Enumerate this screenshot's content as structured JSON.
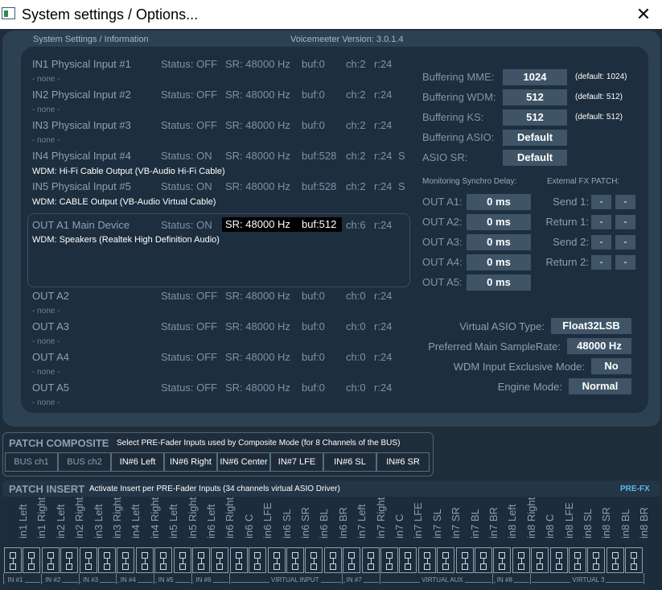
{
  "window": {
    "title": "System settings / Options...",
    "close_glyph": "✕"
  },
  "header": {
    "section": "System Settings / Information",
    "version": "Voicemeeter Version: 3.0.1.4"
  },
  "devices": [
    {
      "name": "IN1 Physical Input #1",
      "status": "Status: OFF",
      "sr": "SR: 48000 Hz",
      "buf": "buf:0",
      "ch": "ch:2",
      "r": "r:24",
      "s": "",
      "sub": "- none -"
    },
    {
      "name": "IN2 Physical Input #2",
      "status": "Status: OFF",
      "sr": "SR: 48000 Hz",
      "buf": "buf:0",
      "ch": "ch:2",
      "r": "r:24",
      "s": "",
      "sub": "- none -"
    },
    {
      "name": "IN3 Physical Input #3",
      "status": "Status: OFF",
      "sr": "SR: 48000 Hz",
      "buf": "buf:0",
      "ch": "ch:2",
      "r": "r:24",
      "s": "",
      "sub": "- none -"
    },
    {
      "name": "IN4 Physical Input #4",
      "status": "Status: ON",
      "sr": "SR: 48000 Hz",
      "buf": "buf:528",
      "ch": "ch:2",
      "r": "r:24",
      "s": "S",
      "sub": "WDM: Hi-Fi Cable Output (VB-Audio Hi-Fi Cable)"
    },
    {
      "name": "IN5 Physical Input #5",
      "status": "Status: ON",
      "sr": "SR: 48000 Hz",
      "buf": "buf:528",
      "ch": "ch:2",
      "r": "r:24",
      "s": "S",
      "sub": "WDM: CABLE Output (VB-Audio Virtual Cable)"
    }
  ],
  "out_a1": {
    "name": "OUT A1 Main Device",
    "status": "Status: ON",
    "sr": "SR: 48000 Hz",
    "buf": "buf:512",
    "ch": "ch:6",
    "r": "r:24",
    "sub": "WDM: Speakers (Realtek High Definition Audio)"
  },
  "outs": [
    {
      "name": "OUT A2",
      "status": "Status: OFF",
      "sr": "SR: 48000 Hz",
      "buf": "buf:0",
      "ch": "ch:0",
      "r": "r:24",
      "sub": "- none -"
    },
    {
      "name": "OUT A3",
      "status": "Status: OFF",
      "sr": "SR: 48000 Hz",
      "buf": "buf:0",
      "ch": "ch:0",
      "r": "r:24",
      "sub": "- none -"
    },
    {
      "name": "OUT A4",
      "status": "Status: OFF",
      "sr": "SR: 48000 Hz",
      "buf": "buf:0",
      "ch": "ch:0",
      "r": "r:24",
      "sub": "- none -"
    },
    {
      "name": "OUT A5",
      "status": "Status: OFF",
      "sr": "SR: 48000 Hz",
      "buf": "buf:0",
      "ch": "ch:0",
      "r": "r:24",
      "sub": "- none -"
    }
  ],
  "buffering": [
    {
      "label": "Buffering MME:",
      "value": "1024",
      "note": "(default: 1024)"
    },
    {
      "label": "Buffering WDM:",
      "value": "512",
      "note": "(default: 512)"
    },
    {
      "label": "Buffering KS:",
      "value": "512",
      "note": "(default: 512)"
    },
    {
      "label": "Buffering ASIO:",
      "value": "Default",
      "note": ""
    },
    {
      "label": "ASIO SR:",
      "value": "Default",
      "note": ""
    }
  ],
  "monitoring": {
    "title": "Monitoring Synchro Delay:",
    "rows": [
      {
        "label": "OUT A1:",
        "value": "0 ms"
      },
      {
        "label": "OUT A2:",
        "value": "0 ms"
      },
      {
        "label": "OUT A3:",
        "value": "0 ms"
      },
      {
        "label": "OUT A4:",
        "value": "0 ms"
      },
      {
        "label": "OUT A5:",
        "value": "0 ms"
      }
    ]
  },
  "fx_patch": {
    "title": "External FX PATCH:",
    "rows": [
      {
        "label": "Send 1:",
        "a": "-",
        "b": "-"
      },
      {
        "label": "Return 1:",
        "a": "-",
        "b": "-"
      },
      {
        "label": "Send 2:",
        "a": "-",
        "b": "-"
      },
      {
        "label": "Return 2:",
        "a": "-",
        "b": "-"
      }
    ]
  },
  "engine": [
    {
      "label": "Virtual ASIO Type:",
      "value": "Float32LSB"
    },
    {
      "label": "Preferred Main SampleRate:",
      "value": "48000 Hz"
    },
    {
      "label": "WDM Input Exclusive Mode:",
      "value": "No"
    },
    {
      "label": "Engine Mode:",
      "value": "Normal"
    }
  ],
  "patch_composite": {
    "title": "PATCH COMPOSITE",
    "desc": "Select PRE-Fader Inputs used by Composite Mode (for 8 Channels of the BUS)",
    "buttons": [
      "BUS ch1",
      "BUS ch2",
      "IN#6 Left",
      "IN#6 Right",
      "IN#6 Center",
      "IN#7 LFE",
      "IN#6 SL",
      "IN#6 SR"
    ]
  },
  "patch_insert": {
    "title": "PATCH INSERT",
    "desc": "Activate Insert per PRE-Fader Inputs (34 channels virtual ASIO Driver)",
    "prefx": "PRE-FX",
    "channels": [
      "in1 Left",
      "in1 Right",
      "in2 Left",
      "in2 Right",
      "in3 Left",
      "in3 Right",
      "in4 Left",
      "in4 Right",
      "in5 Left",
      "in5 Right",
      "in6 Left",
      "in6 Right",
      "in6 C",
      "in6 LFE",
      "in6 SL",
      "in6 SR",
      "in6 BL",
      "in6 BR",
      "in7 Left",
      "in7 Right",
      "in7 C",
      "in7 LFE",
      "in7 SL",
      "in7 SR",
      "in7 BL",
      "in7 BR",
      "in8 Left",
      "in8 Right",
      "in8 C",
      "in8 LFE",
      "in8 SL",
      "in8 SR",
      "in8 BL",
      "in8 BR"
    ],
    "groups": [
      "IN #1",
      "IN #2",
      "IN #3",
      "IN #4",
      "IN #5",
      "IN #6",
      "VIRTUAL INPUT",
      "IN #7",
      "VIRTUAL AUX",
      "IN #8",
      "VIRTUAL 3"
    ]
  }
}
